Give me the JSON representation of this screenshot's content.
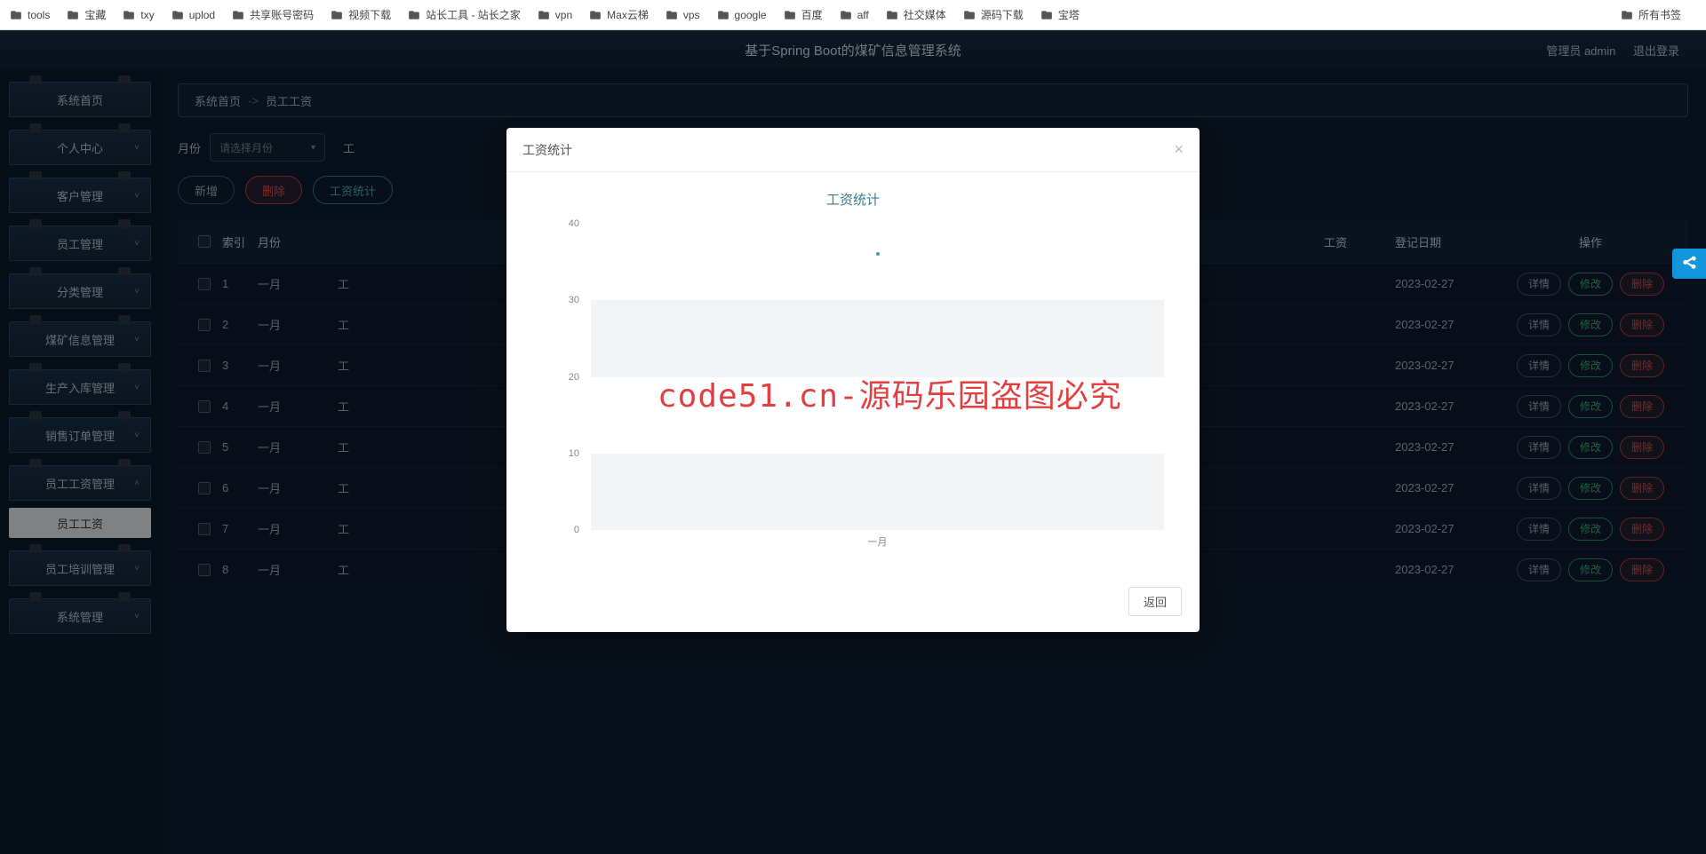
{
  "bookmarks": {
    "items": [
      {
        "label": "tools",
        "icon": "folder"
      },
      {
        "label": "宝藏",
        "icon": "folder"
      },
      {
        "label": "txy",
        "icon": "cloud"
      },
      {
        "label": "uplod",
        "icon": "upload"
      },
      {
        "label": "共享账号密码",
        "icon": "doc"
      },
      {
        "label": "视频下载",
        "icon": "folder"
      },
      {
        "label": "站长工具 - 站长之家",
        "icon": "tool"
      },
      {
        "label": "vpn",
        "icon": "folder"
      },
      {
        "label": "Max云梯",
        "icon": "folder"
      },
      {
        "label": "vps",
        "icon": "folder"
      },
      {
        "label": "google",
        "icon": "folder"
      },
      {
        "label": "百度",
        "icon": "baidu"
      },
      {
        "label": "aff",
        "icon": "folder"
      },
      {
        "label": "社交媒体",
        "icon": "folder"
      },
      {
        "label": "源码下载",
        "icon": "folder"
      },
      {
        "label": "宝塔",
        "icon": "folder"
      }
    ],
    "right_label": "所有书签"
  },
  "header": {
    "title": "基于Spring Boot的煤矿信息管理系统",
    "user_role": "管理员 admin",
    "logout": "退出登录"
  },
  "sidebar": {
    "items": [
      {
        "label": "系统首页",
        "expandable": false
      },
      {
        "label": "个人中心",
        "expandable": true
      },
      {
        "label": "客户管理",
        "expandable": true
      },
      {
        "label": "员工管理",
        "expandable": true
      },
      {
        "label": "分类管理",
        "expandable": true
      },
      {
        "label": "煤矿信息管理",
        "expandable": true
      },
      {
        "label": "生产入库管理",
        "expandable": true
      },
      {
        "label": "销售订单管理",
        "expandable": true
      },
      {
        "label": "员工工资管理",
        "expandable": true,
        "expanded": true,
        "sub": "员工工资"
      },
      {
        "label": "员工培训管理",
        "expandable": true
      },
      {
        "label": "系统管理",
        "expandable": true
      }
    ]
  },
  "breadcrumb": {
    "home": "系统首页",
    "current": "员工工资"
  },
  "filter": {
    "month_label": "月份",
    "month_placeholder": "请选择月份",
    "emp_label": "工"
  },
  "actions": {
    "add": "新增",
    "delete": "删除",
    "stats": "工资统计"
  },
  "table": {
    "columns": {
      "index": "索引",
      "month": "月份",
      "salary": "工资",
      "date": "登记日期",
      "ops": "操作"
    },
    "ops": {
      "detail": "详情",
      "edit": "修改",
      "delete": "删除"
    },
    "rows": [
      {
        "idx": "1",
        "month": "一月",
        "prefix": "工",
        "date": "2023-02-27"
      },
      {
        "idx": "2",
        "month": "一月",
        "prefix": "工",
        "date": "2023-02-27"
      },
      {
        "idx": "3",
        "month": "一月",
        "prefix": "工",
        "date": "2023-02-27"
      },
      {
        "idx": "4",
        "month": "一月",
        "prefix": "工",
        "date": "2023-02-27"
      },
      {
        "idx": "5",
        "month": "一月",
        "prefix": "工",
        "date": "2023-02-27"
      },
      {
        "idx": "6",
        "month": "一月",
        "prefix": "工",
        "date": "2023-02-27"
      },
      {
        "idx": "7",
        "month": "一月",
        "prefix": "工",
        "date": "2023-02-27"
      },
      {
        "idx": "8",
        "month": "一月",
        "prefix": "工",
        "date": "2023-02-27"
      }
    ]
  },
  "modal": {
    "title": "工资统计",
    "chart_title": "工资统计",
    "return_btn": "返回",
    "watermark": "code51.cn-源码乐园盗图必究"
  },
  "chart_data": {
    "type": "line",
    "categories": [
      "一月"
    ],
    "values": [
      36
    ],
    "title": "工资统计",
    "xlabel": "",
    "ylabel": "",
    "ylim": [
      0,
      40
    ],
    "yticks": [
      0,
      10,
      20,
      30,
      40
    ]
  }
}
